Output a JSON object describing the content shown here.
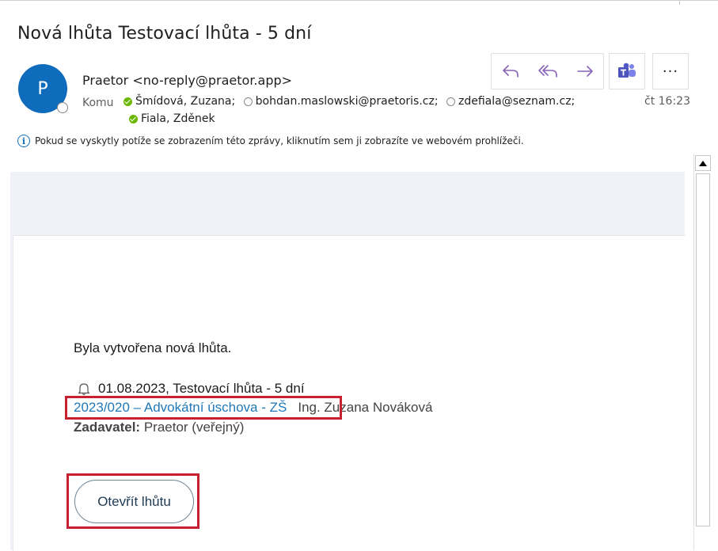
{
  "email": {
    "subject": "Nová lhůta Testovací lhůta - 5 dní",
    "avatar_letter": "P",
    "sender": "Praetor <no-reply@praetor.app>",
    "to_label": "Komu",
    "recipients": [
      {
        "name": "Šmídová, Zuzana;",
        "status": "available"
      },
      {
        "name": "bohdan.maslowski@praetoris.cz;",
        "status": "unknown"
      },
      {
        "name": "zdefiala@seznam.cz;",
        "status": "unknown"
      },
      {
        "name": "Fiala, Zděnek",
        "status": "available"
      }
    ],
    "time": "čt 16:23",
    "info_text": "Pokud se vyskytly potíže se zobrazením této zprávy, kliknutím sem ji zobrazíte ve webovém prohlížeči."
  },
  "toolbar": {
    "icons": [
      "reply-icon",
      "reply-all-icon",
      "forward-icon",
      "teams-icon",
      "more-icon"
    ],
    "more_label": "···"
  },
  "message": {
    "intro": "Byla vytvořena nová lhůta.",
    "deadline": "01.08.2023, Testovací lhůta - 5 dní",
    "case_link": "2023/020 – Advokátní úschova - ZŠ",
    "person": "Ing. Zuzana Nováková",
    "requester_label": "Zadavatel:",
    "requester_value": "Praetor (veřejný)",
    "open_button": "Otevřít lhůtu"
  },
  "colors": {
    "avatar": "#0f6cbd",
    "link": "#2279b7",
    "highlight": "#c8202f",
    "available": "#6bb700",
    "toolbar_icon": "#8764b8"
  }
}
